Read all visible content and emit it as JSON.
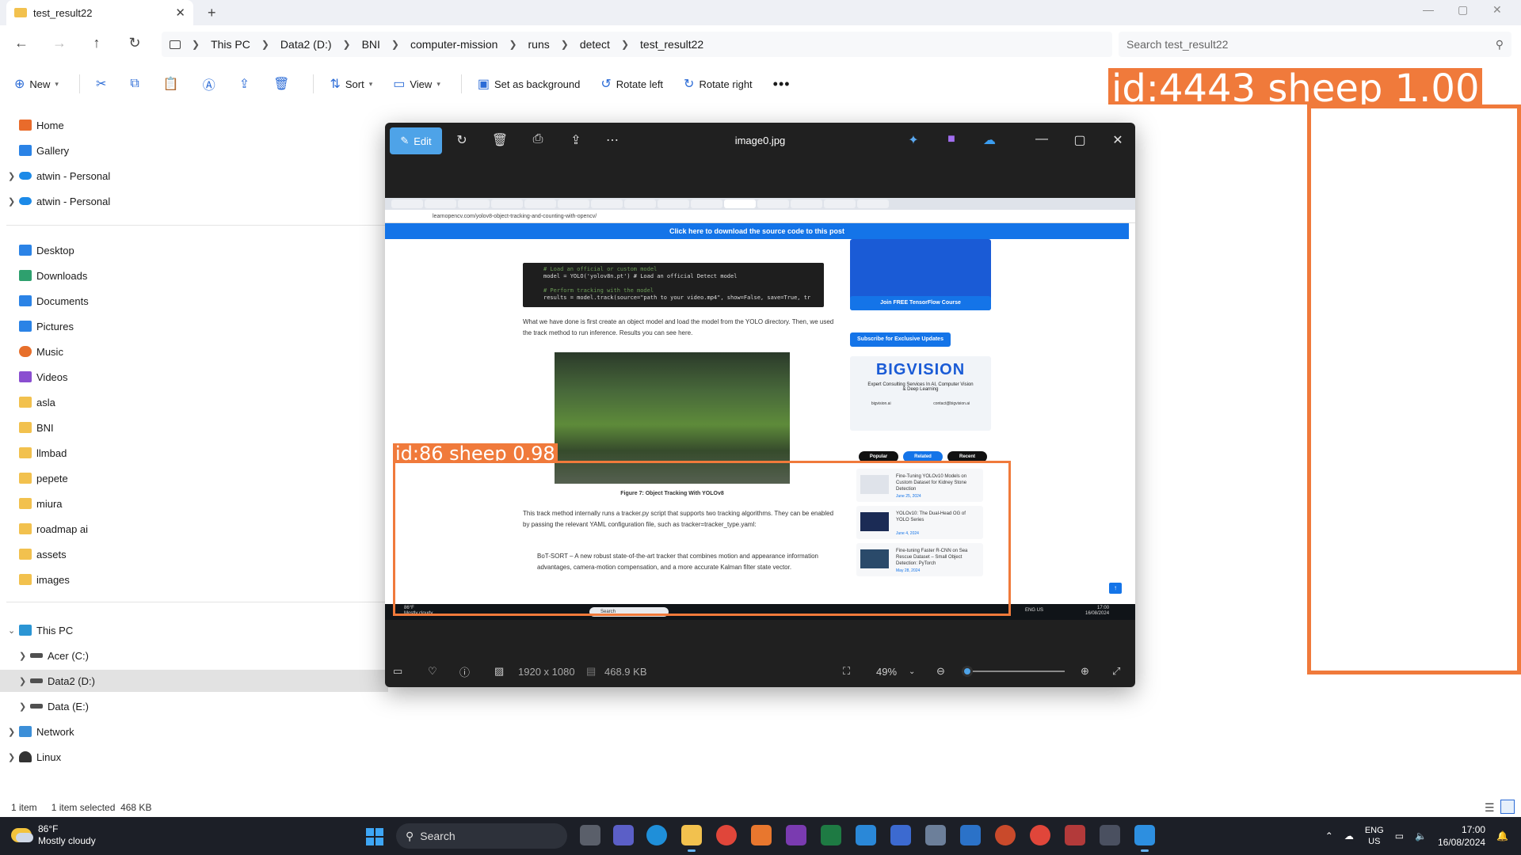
{
  "explorer": {
    "tab_title": "test_result22",
    "breadcrumb": [
      "This PC",
      "Data2 (D:)",
      "BNI",
      "computer-mission",
      "runs",
      "detect",
      "test_result22"
    ],
    "search_placeholder": "Search test_result22",
    "commands": {
      "new": "New",
      "sort": "Sort",
      "view": "View",
      "set_background": "Set as background",
      "rotate_left": "Rotate left",
      "rotate_right": "Rotate right"
    },
    "sidebar": {
      "quick": [
        {
          "label": "Home",
          "icon": "home-icon"
        },
        {
          "label": "Gallery",
          "icon": "gallery-icon"
        },
        {
          "label": "atwin - Personal",
          "icon": "onedrive-icon"
        },
        {
          "label": "atwin - Personal",
          "icon": "onedrive-icon"
        }
      ],
      "pinned": [
        {
          "label": "Desktop",
          "icon": "desktop-icon"
        },
        {
          "label": "Downloads",
          "icon": "download-icon"
        },
        {
          "label": "Documents",
          "icon": "documents-icon"
        },
        {
          "label": "Pictures",
          "icon": "pictures-icon"
        },
        {
          "label": "Music",
          "icon": "music-icon"
        },
        {
          "label": "Videos",
          "icon": "videos-icon"
        },
        {
          "label": "asla",
          "icon": "folder-icon"
        },
        {
          "label": "BNI",
          "icon": "folder-icon"
        },
        {
          "label": "llmbad",
          "icon": "folder-icon"
        },
        {
          "label": "pepete",
          "icon": "folder-icon"
        },
        {
          "label": "miura",
          "icon": "folder-icon"
        },
        {
          "label": "roadmap ai",
          "icon": "folder-icon"
        },
        {
          "label": "assets",
          "icon": "folder-icon"
        },
        {
          "label": "images",
          "icon": "folder-icon"
        }
      ],
      "this_pc": "This PC",
      "drives": [
        {
          "label": "Acer (C:)"
        },
        {
          "label": "Data2 (D:)"
        },
        {
          "label": "Data (E:)"
        }
      ],
      "network": "Network",
      "linux": "Linux"
    },
    "status": {
      "count": "1 item",
      "selected": "1 item selected",
      "size": "468 KB"
    }
  },
  "detections": {
    "outer": "id:4443 sheep 1.00",
    "inner": "id:86 sheep 0.98"
  },
  "viewer": {
    "edit_label": "Edit",
    "title": "image0.jpg",
    "dimensions": "1920 x 1080",
    "filesize": "468.9 KB",
    "zoom": "49%",
    "zoom_level": 0.05,
    "inner": {
      "url": "learnopencv.com/yolov8-object-tracking-and-counting-with-opencv/",
      "banner": "Click here to download the source code to this post",
      "code": [
        "# Load an official or custom model",
        "model = YOLO('yolov8n.pt')  # Load an official Detect model",
        "",
        "# Perform tracking with the model",
        "results = model.track(source=\"path to your video.mp4\", show=False, save=True, tr"
      ],
      "para1": "What we have done is first create an object model and load the model from the YOLO directory. Then, we used the track method to run inference. Results you can see here.",
      "figure_caption": "Figure 7: Object Tracking With YOLOv8",
      "para2": "This track method internally runs a tracker.py script that supports two tracking algorithms. They can be enabled by passing the relevant YAML configuration file, such as tracker=tracker_type.yaml:",
      "bullet": "BoT-SORT – A new robust state-of-the-art tracker that combines motion and appearance information advantages, camera-motion compensation, and a more accurate Kalman filter state vector.",
      "tf_button": "Join FREE TensorFlow Course",
      "subscribe": "Subscribe for Exclusive Updates",
      "bigvision_logo": "BIGVISION",
      "bigvision_tag": "Expert Consulting Services In AI, Computer Vision & Deep Learning",
      "bigvision_site": "bigvision.ai",
      "bigvision_mail": "contact@bigvision.ai",
      "tabs": [
        "Popular",
        "Related",
        "Recent"
      ],
      "posts": [
        {
          "title": "Fine-Tuning YOLOv10 Models on Custom Dataset for Kidney Stone Detection",
          "date": "June 25, 2024"
        },
        {
          "title": "YOLOv10: The Dual-Head OG of YOLO Series",
          "date": "June 4, 2024"
        },
        {
          "title": "Fine-tuning Faster R-CNN on Sea Rescue Dataset – Small Object Detection: PyTorch",
          "date": "May 28, 2024"
        }
      ],
      "inner_weather": "86°F",
      "inner_weather2": "Mostly cloudy",
      "inner_search": "Search",
      "inner_time": "17:00",
      "inner_date": "16/08/2024",
      "inner_lang": "ENG US"
    }
  },
  "taskbar": {
    "temp": "86°F",
    "condition": "Mostly cloudy",
    "search": "Search",
    "lang1": "ENG",
    "lang2": "US",
    "time": "17:00",
    "date": "16/08/2024"
  },
  "colors": {
    "detection": "#f07a3b",
    "accent": "#4ea3e8",
    "banner": "#1474e8"
  }
}
